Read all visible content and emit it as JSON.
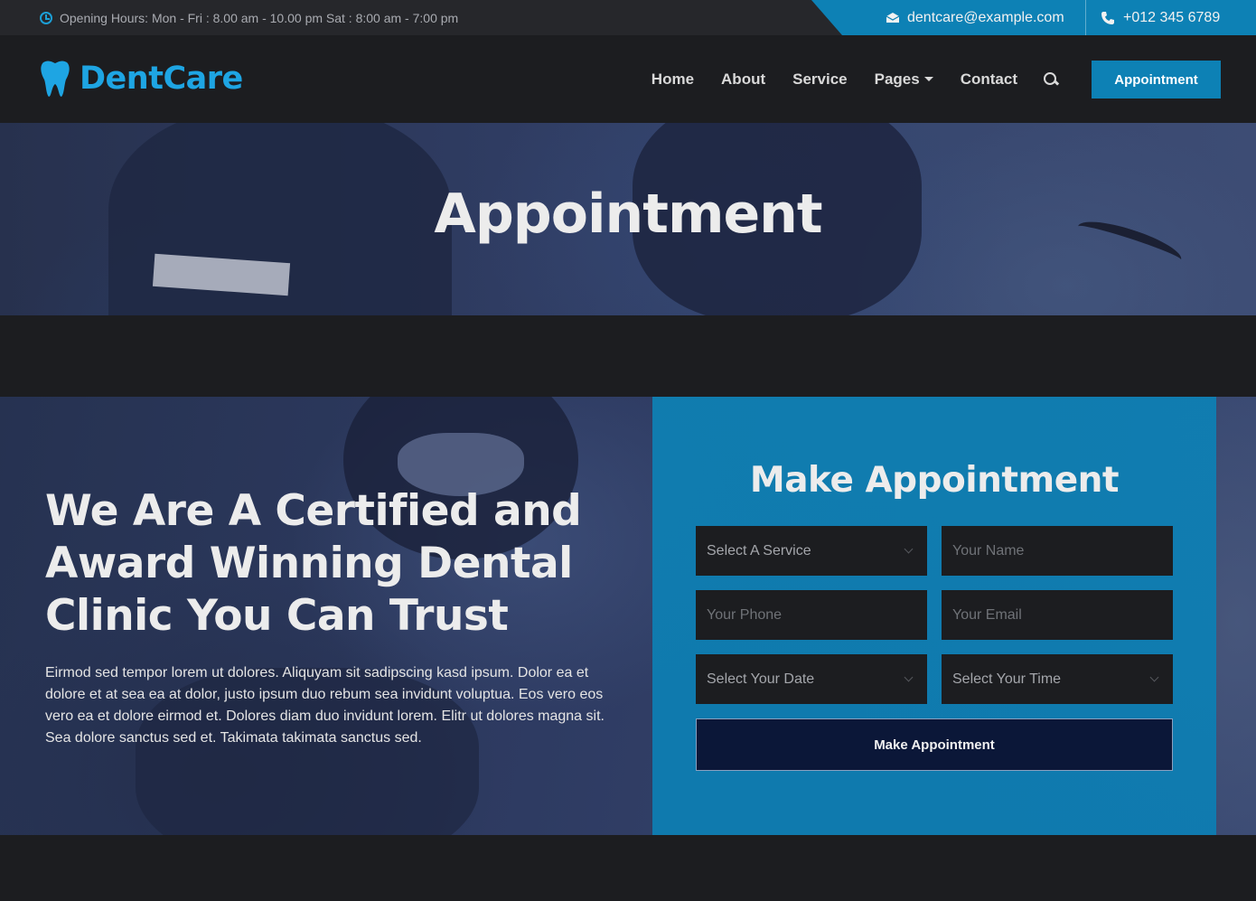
{
  "topbar": {
    "hours": "Opening Hours: Mon - Fri : 8.00 am - 10.00 pm Sat : 8:00 am - 7:00 pm",
    "email": "dentcare@example.com",
    "phone": "+012 345 6789"
  },
  "brand": {
    "name": "DentCare",
    "accent": "#1ea5e3"
  },
  "nav": {
    "items": [
      "Home",
      "About",
      "Service",
      "Pages",
      "Contact"
    ],
    "cta": "Appointment"
  },
  "header": {
    "title": "Appointment"
  },
  "about": {
    "headline": "We Are A Certified and Award Winning Dental Clinic You Can Trust",
    "text": "Eirmod sed tempor lorem ut dolores. Aliquyam sit sadipscing kasd ipsum. Dolor ea et dolore et at sea ea at dolor, justo ipsum duo rebum sea invidunt voluptua. Eos vero eos vero ea et dolore eirmod et. Dolores diam duo invidunt lorem. Elitr ut dolores magna sit. Sea dolore sanctus sed et. Takimata takimata sanctus sed."
  },
  "form": {
    "title": "Make Appointment",
    "service": "Select A Service",
    "name_placeholder": "Your Name",
    "phone_placeholder": "Your Phone",
    "email_placeholder": "Your Email",
    "date": "Select Your Date",
    "time": "Select Your Time",
    "submit": "Make Appointment"
  },
  "colors": {
    "primary": "#0d81b5",
    "dark": "#1c1d20",
    "navy": "#0b1738"
  }
}
